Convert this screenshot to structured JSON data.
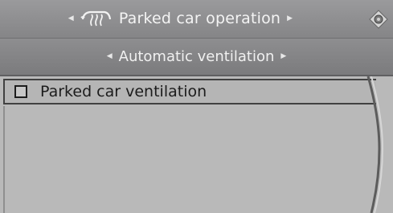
{
  "header": {
    "title": "Parked car operation",
    "icon": "parked-car-ventilation-icon",
    "right_icon": "controller-knob-icon"
  },
  "subheader": {
    "title": "Automatic ventilation"
  },
  "menu": {
    "items": [
      {
        "label": "Parked car ventilation",
        "checked": false
      }
    ]
  },
  "colors": {
    "header_bg": "#8e8e90",
    "content_bg": "#b9b9b9",
    "text_light": "#f4f4f4",
    "text_dark": "#1c1c1c",
    "watermark": "#5073d2"
  }
}
